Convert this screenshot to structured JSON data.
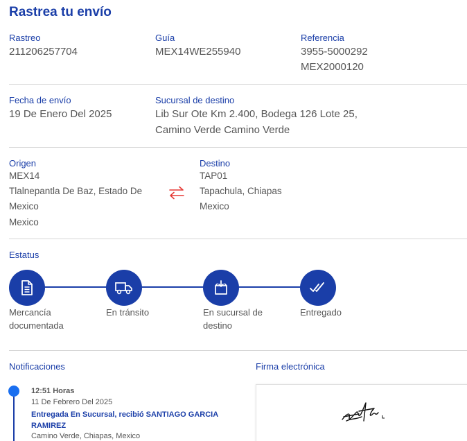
{
  "page_title": "Rastrea tu envío",
  "shipment": {
    "rastreo_label": "Rastreo",
    "rastreo_value": "211206257704",
    "guia_label": "Guía",
    "guia_value": "MEX14WE255940",
    "referencia_label": "Referencia",
    "referencia_line1": "3955-5000292",
    "referencia_line2": "MEX2000120",
    "fecha_label": "Fecha de envío",
    "fecha_value": "19 De Enero Del 2025",
    "sucursal_label": "Sucursal de destino",
    "sucursal_line1": "Lib Sur Ote Km 2.400, Bodega 126 Lote 25,",
    "sucursal_line2": "Camino Verde Camino Verde"
  },
  "route": {
    "origen_label": "Origen",
    "origen_code": "MEX14",
    "origen_line1": "Tlalnepantla De Baz, Estado De",
    "origen_line2": "Mexico",
    "origen_line3": "Mexico",
    "destino_label": "Destino",
    "destino_code": "TAP01",
    "destino_line1": "Tapachula, Chiapas",
    "destino_line2": "Mexico",
    "swap_icon": "swap-arrows-icon",
    "swap_color": "#e53935"
  },
  "status": {
    "label": "Estatus",
    "accent_color": "#1a3ea8",
    "steps": [
      {
        "line1": "Mercancía",
        "line2": "documentada",
        "icon": "document-icon"
      },
      {
        "line1": "En tránsito",
        "line2": "",
        "icon": "truck-icon"
      },
      {
        "line1": "En sucursal de",
        "line2": "destino",
        "icon": "package-icon"
      },
      {
        "line1": "Entregado",
        "line2": "",
        "icon": "double-check-icon"
      }
    ]
  },
  "notifications": {
    "label": "Notificaciones",
    "items": [
      {
        "time": "12:51 Horas",
        "date": "11 De Febrero Del 2025",
        "event_line1": "Entregada En Sucursal, recibió SANTIAGO GARCIA",
        "event_line2": "RAMIREZ",
        "place": "Camino Verde, Chiapas, Mexico"
      }
    ]
  },
  "signature": {
    "label": "Firma electrónica"
  }
}
